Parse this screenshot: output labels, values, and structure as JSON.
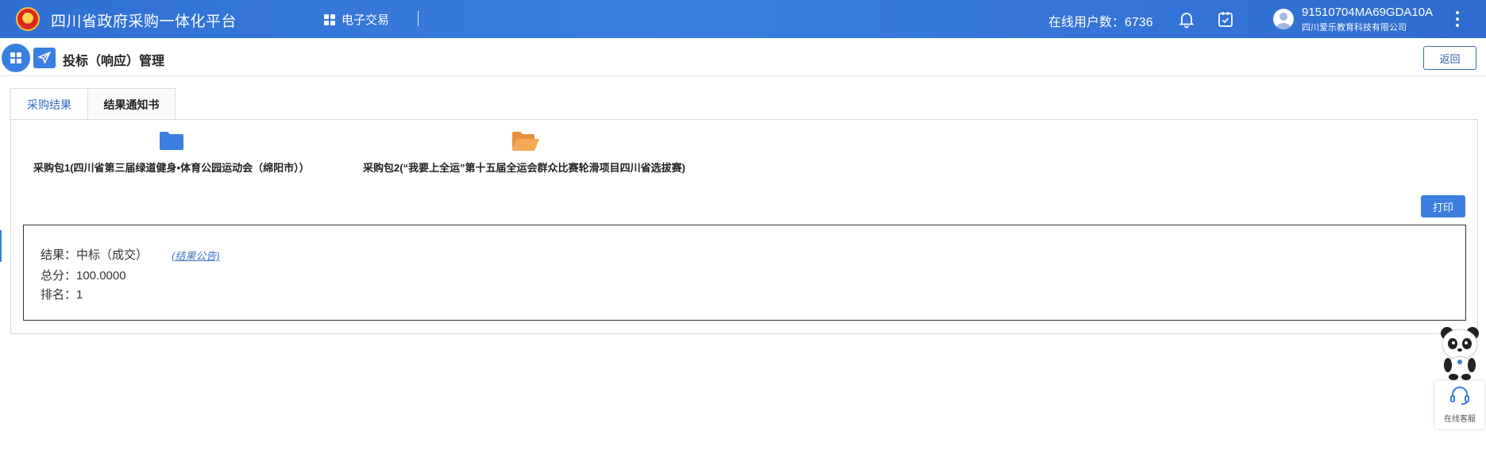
{
  "header": {
    "platform_title": "四川省政府采购一体化平台",
    "nav_trade": "电子交易",
    "online_users": "在线用户数：6736",
    "user_id": "91510704MA69GDA10A",
    "user_company": "四川爱乐教育科技有限公司",
    "icons": [
      "emblem-logo",
      "grid-icon",
      "bell-icon",
      "task-check-icon",
      "user-avatar-icon",
      "more-vertical-icon"
    ]
  },
  "page": {
    "title": "投标（响应）管理",
    "back_label": "返回"
  },
  "tabs": [
    {
      "label": "采购结果",
      "active": true
    },
    {
      "label": "结果通知书",
      "active": false
    }
  ],
  "packages": [
    {
      "label": "采购包1(四川省第三届绿道健身•体育公园运动会（绵阳市））",
      "icon": "folder-closed-icon",
      "color": "#3a7ee0"
    },
    {
      "label": "采购包2(“我要上全运”第十五届全运会群众比赛轮滑项目四川省选拔赛)",
      "icon": "folder-open-icon",
      "color": "#f0a04b"
    }
  ],
  "print_label": "打印",
  "result": {
    "result_line": "结果：中标（成交）",
    "link_label": "(结果公告)",
    "score_line": "总分：100.0000",
    "rank_line": "排名：1"
  },
  "service": {
    "label": "在线客服"
  },
  "colors": {
    "header_blue": "#3b7de0",
    "accent_blue": "#3a7ee0",
    "folder_orange": "#f0a04b"
  }
}
